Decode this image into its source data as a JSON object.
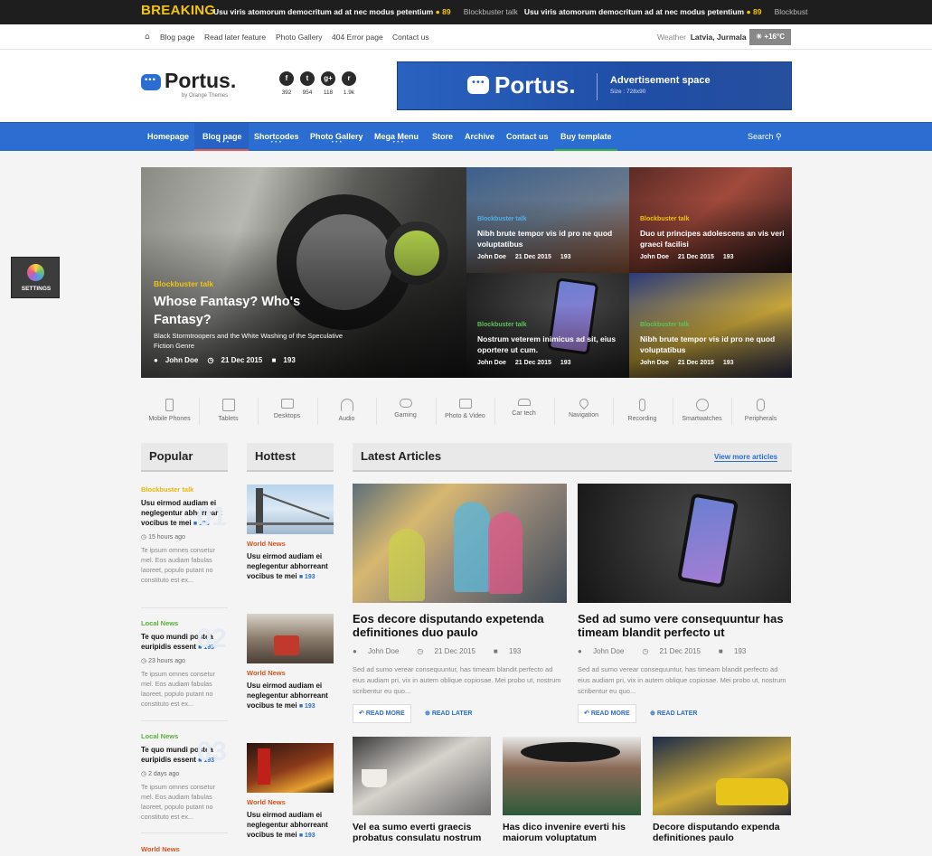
{
  "breaking": {
    "label": "BREAKING",
    "items": [
      {
        "category": "Usu viris atomorum democritum ad at nec modus petentium",
        "count": "89"
      },
      {
        "category": "Blockbuster talk",
        "title": "Usu viris atomorum democritum ad at nec modus petentium",
        "count": "89"
      },
      {
        "category": "Blockbust"
      }
    ]
  },
  "topnav": {
    "links": [
      "Blog page",
      "Read later feature",
      "Photo Gallery",
      "404 Error page",
      "Contact us"
    ],
    "weather_label": "Weather",
    "location": "Latvia, Jurmala",
    "temperature": "+16°C"
  },
  "logo": {
    "name": "Portus.",
    "by": "by Orange Themes"
  },
  "social": [
    {
      "icon": "facebook-icon",
      "glyph": "f",
      "count": "392"
    },
    {
      "icon": "twitter-icon",
      "glyph": "t",
      "count": "954"
    },
    {
      "icon": "google-plus-icon",
      "glyph": "g+",
      "count": "118"
    },
    {
      "icon": "rss-icon",
      "glyph": "r",
      "count": "1.9k"
    }
  ],
  "ad": {
    "name": "Portus.",
    "title": "Advertisement space",
    "size": "Size : 728x90"
  },
  "mainnav": {
    "items": [
      "Homepage",
      "Blog page",
      "Shortcodes",
      "Photo Gallery",
      "Mega Menu",
      "Store",
      "Archive",
      "Contact us",
      "Buy template"
    ],
    "search": "Search"
  },
  "settings": {
    "label": "SETTINGS"
  },
  "hero": {
    "main": {
      "category": "Blockbuster talk",
      "title": "Whose Fantasy? Who's Fantasy?",
      "subtitle": "Black Stormtroopers and the White Washing of the Speculative Fiction Genre",
      "author": "John Doe",
      "date": "21 Dec 2015",
      "comments": "193"
    },
    "tiles": [
      {
        "category": "Blockbuster talk",
        "title": "Nibh brute tempor vis id pro ne quod voluptatibus",
        "author": "John Doe",
        "date": "21 Dec 2015",
        "comments": "193"
      },
      {
        "category": "Blockbuster talk",
        "title": "Duo ut principes adolescens an vis veri graeci facilisi",
        "author": "John Doe",
        "date": "21 Dec 2015",
        "comments": "193"
      },
      {
        "category": "Blockbuster talk",
        "title": "Nostrum veterem inimicus ad sit, eius oportere ut cum.",
        "author": "John Doe",
        "date": "21 Dec 2015",
        "comments": "193"
      },
      {
        "category": "Blockbuster talk",
        "title": "Nibh brute tempor vis id pro ne quod voluptatibus",
        "author": "John Doe",
        "date": "21 Dec 2015",
        "comments": "193"
      }
    ]
  },
  "categories": [
    "Mobile Phones",
    "Tablets",
    "Desktops",
    "Audio",
    "Gaming",
    "Photo & Video",
    "Car tech",
    "Navigation",
    "Recording",
    "Smartwatches",
    "Peripherals"
  ],
  "popular": {
    "heading": "Popular",
    "items": [
      {
        "category": "Blockbuster talk",
        "title": "Usu eirmod audiam ei neglegentur abhorreant vocibus te mei",
        "comments": "193",
        "time": "15 hours ago",
        "excerpt": "Te ipsum omnes consetur mel. Eos audiam fabulas laoreet, populo putant no constituto est ex...",
        "number": "01"
      },
      {
        "category": "Local News",
        "title": "Te quo mundi postea euripidis essent",
        "comments": "193",
        "time": "23 hours ago",
        "excerpt": "Te ipsum omnes consetur mel. Eos audiam fabulas laoreet, populo putant no constituto est ex...",
        "number": "02"
      },
      {
        "category": "Local News",
        "title": "Te quo mundi postea euripidis essent",
        "comments": "193",
        "time": "2 days ago",
        "excerpt": "Te ipsum omnes consetur mel. Eos audiam fabulas laoreet, populo putant no constituto est ex...",
        "number": "03"
      },
      {
        "category": "World News"
      }
    ]
  },
  "hottest": {
    "heading": "Hottest",
    "items": [
      {
        "category": "World News",
        "title": "Usu eirmod audiam ei neglegentur abhorreant vocibus te mei",
        "comments": "193"
      },
      {
        "category": "World News",
        "title": "Usu eirmod audiam ei neglegentur abhorreant vocibus te mei",
        "comments": "193"
      },
      {
        "category": "World News",
        "title": "Usu eirmod audiam ei neglegentur abhorreant vocibus te mei",
        "comments": "193"
      }
    ]
  },
  "latest": {
    "heading": "Latest Articles",
    "view_more": "View more articles",
    "articles": [
      {
        "title": "Eos decore disputando expetenda definitiones duo paulo",
        "author": "John Doe",
        "date": "21 Dec 2015",
        "comments": "193",
        "excerpt": "Sed ad sumo verear consequuntur, has timeam blandit perfecto ad eius audiam pri, vix in autem oblique copiosae. Mei probo ut, nostrum scribentur eu quo...",
        "read_more": "READ MORE",
        "read_later": "READ LATER"
      },
      {
        "title": "Sed ad sumo vere consequuntur has timeam blandit perfecto ut",
        "author": "John Doe",
        "date": "21 Dec 2015",
        "comments": "193",
        "excerpt": "Sed ad sumo verear consequuntur, has timeam blandit perfecto ad eius audiam pri, vix in autem oblique copiosae. Mei probo ut, nostrum scribentur eu quo...",
        "read_more": "READ MORE",
        "read_later": "READ LATER"
      }
    ],
    "small": [
      {
        "title": "Vel ea sumo everti graecis probatus consulatu nostrum"
      },
      {
        "title": "Has dico invenire everti his maiorum voluptatum"
      },
      {
        "title": "Decore disputando expenda definitiones paulo"
      }
    ]
  }
}
